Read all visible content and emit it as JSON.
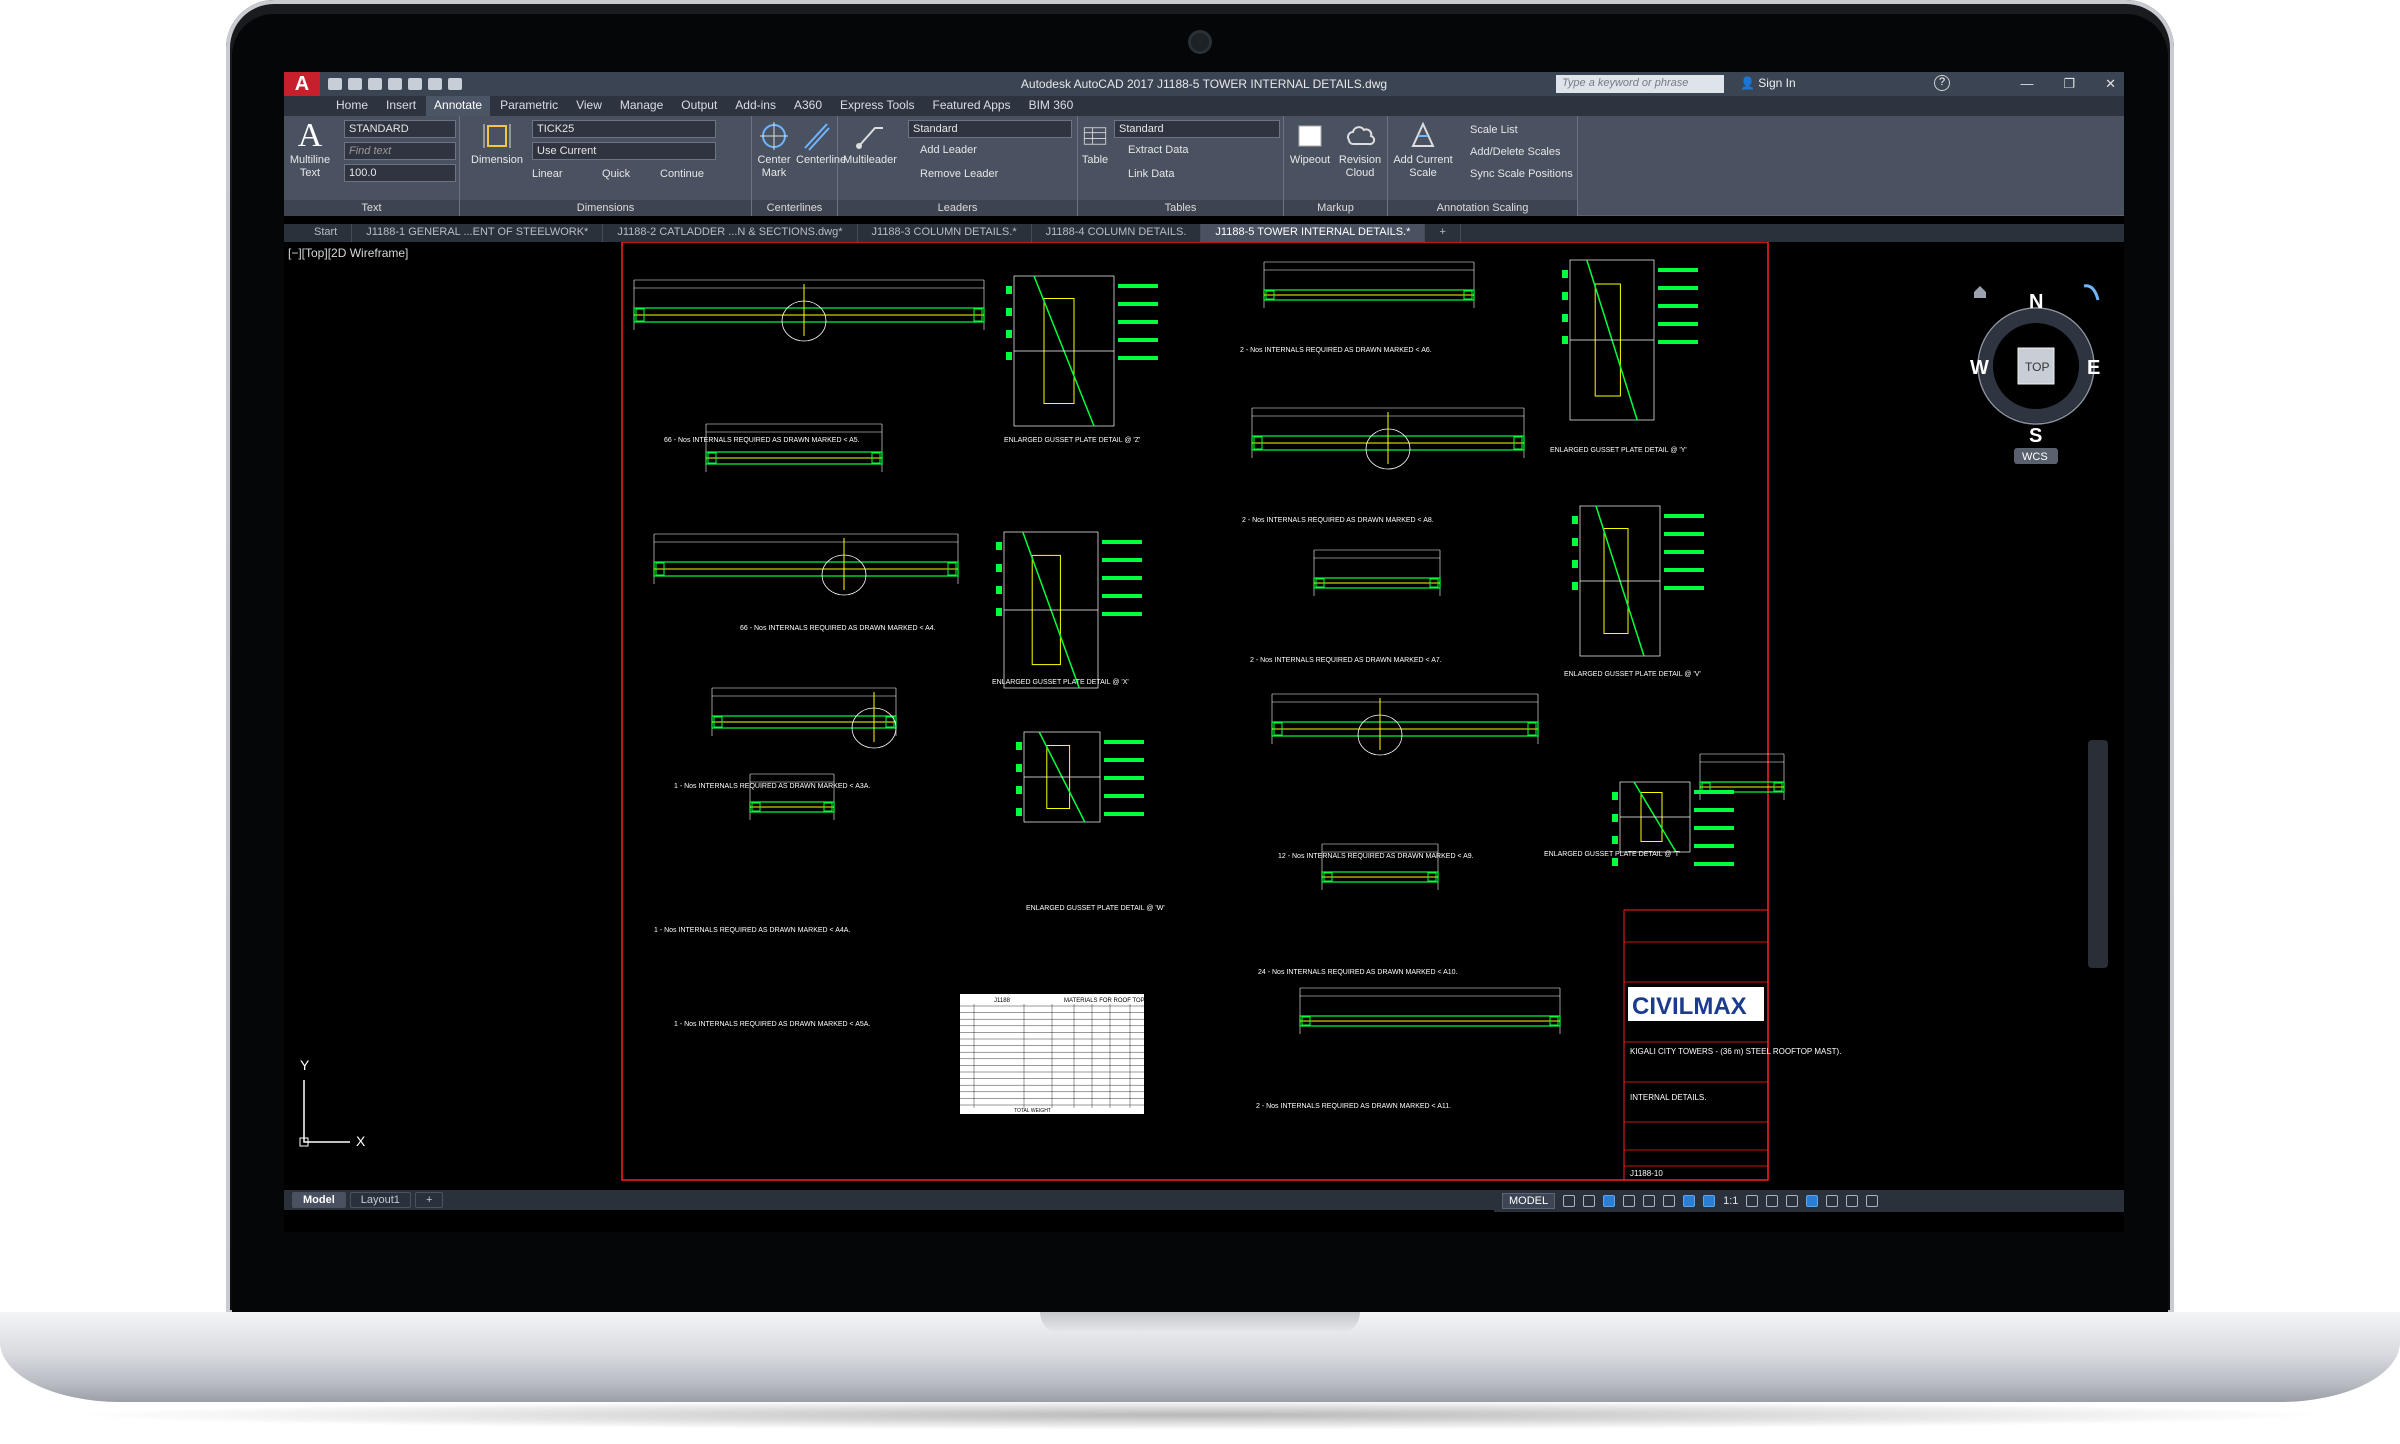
{
  "titlebar": {
    "app_logo": "A",
    "title": "Autodesk AutoCAD 2017   J1188-5 TOWER INTERNAL  DETAILS.dwg",
    "search_placeholder": "Type a keyword or phrase",
    "signin": "Sign In",
    "help": "?"
  },
  "ribbon_tabs": [
    "Home",
    "Insert",
    "Annotate",
    "Parametric",
    "View",
    "Manage",
    "Output",
    "Add-ins",
    "A360",
    "Express Tools",
    "Featured Apps",
    "BIM 360"
  ],
  "ribbon": {
    "text": {
      "multiline": "Multiline Text",
      "style": "STANDARD",
      "find": "Find text",
      "height": "100.0",
      "label": "Text"
    },
    "dimensions": {
      "dimension": "Dimension",
      "style": "TICK25",
      "layer": "Use Current",
      "linear": "Linear",
      "quick": "Quick",
      "continue": "Continue",
      "label": "Dimensions"
    },
    "centerlines": {
      "center_mark": "Center Mark",
      "centerline": "Centerline",
      "label": "Centerlines"
    },
    "leaders": {
      "multileader": "Multileader",
      "style": "Standard",
      "add": "Add Leader",
      "remove": "Remove Leader",
      "label": "Leaders"
    },
    "tables": {
      "table": "Table",
      "style": "Standard",
      "extract": "Extract Data",
      "link": "Link Data",
      "label": "Tables"
    },
    "markup": {
      "wipeout": "Wipeout",
      "revision_cloud": "Revision Cloud",
      "label": "Markup"
    },
    "annotation_scaling": {
      "add_scale": "Add Current Scale",
      "scale_list": "Scale List",
      "add_delete": "Add/Delete Scales",
      "sync": "Sync Scale Positions",
      "label": "Annotation Scaling"
    }
  },
  "doc_tabs": [
    "Start",
    "J1188-1  GENERAL ...ENT OF STEELWORK*",
    "J1188-2 CATLADDER ...N & SECTIONS.dwg*",
    "J1188-3 COLUMN  DETAILS.*",
    "J1188-4 COLUMN  DETAILS.",
    "J1188-5 TOWER INTERNAL  DETAILS.*"
  ],
  "viewport": {
    "label": "[−][Top][2D Wireframe]"
  },
  "viewcube": {
    "n": "N",
    "s": "S",
    "e": "E",
    "w": "W",
    "top": "TOP",
    "wcs": "WCS"
  },
  "ucs": {
    "x": "X",
    "y": "Y"
  },
  "drawing": {
    "captions": [
      "66 - Nos INTERNALS REQUIRED AS DRAWN MARKED < A5.",
      "66 - Nos INTERNALS REQUIRED AS DRAWN MARKED < A4.",
      "1 - Nos INTERNALS REQUIRED AS DRAWN MARKED < A3A.",
      "1 - Nos INTERNALS REQUIRED AS DRAWN MARKED < A4A.",
      "1 - Nos INTERNALS REQUIRED AS DRAWN MARKED < A5A.",
      "2 - Nos INTERNALS REQUIRED AS DRAWN MARKED < A6.",
      "2 - Nos INTERNALS REQUIRED AS DRAWN MARKED < A8.",
      "2 - Nos INTERNALS REQUIRED AS DRAWN MARKED < A7.",
      "12 - Nos INTERNALS REQUIRED AS DRAWN MARKED < A9.",
      "24 - Nos INTERNALS REQUIRED AS DRAWN MARKED < A10.",
      "2 - Nos INTERNALS REQUIRED AS DRAWN MARKED < A11.",
      "ENLARGED GUSSET PLATE DETAIL @ 'Z'",
      "ENLARGED GUSSET PLATE DETAIL @ 'X'",
      "ENLARGED GUSSET PLATE DETAIL @ 'W'",
      "ENLARGED GUSSET PLATE DETAIL @ 'Y'",
      "ENLARGED GUSSET PLATE DETAIL @ 'V'",
      "ENLARGED GUSSET PLATE DETAIL @ 'T'"
    ],
    "table_head": [
      "J1188",
      "MATERIALS FOR ROOF TOP MAST"
    ],
    "table_total": "TOTAL WEIGHT",
    "titleblock": {
      "logo": "CIVILMAX",
      "project": "KIGALI CITY TOWERS - (36 m) STEEL ROOFTOP MAST).",
      "title": "INTERNAL  DETAILS.",
      "number": "J1188-10"
    }
  },
  "layout_tabs": [
    "Model",
    "Layout1",
    "+"
  ],
  "status": {
    "model": "MODEL",
    "scale": "1:1"
  },
  "colors": {
    "titlebar": "#3b4453",
    "ribbon": "#4a5160",
    "drawing_green": "#00ff3c",
    "drawing_yellow": "#ffff00",
    "border_red": "#ff0000",
    "accent_blue": "#2a7fd4"
  }
}
